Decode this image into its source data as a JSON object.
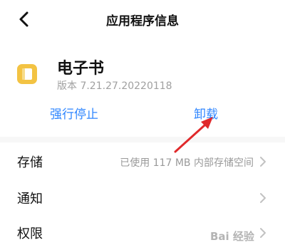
{
  "header": {
    "title": "应用程序信息",
    "back_icon": "chevron-left-icon"
  },
  "app": {
    "name": "电子书",
    "version": "版本 7.21.27.20220118",
    "icon": "ebook-app-icon",
    "icon_color": "#f3c343"
  },
  "actions": {
    "force_stop": "强行停止",
    "uninstall": "卸载",
    "accent_color": "#2f86ff"
  },
  "settings": {
    "rows": [
      {
        "label": "存储",
        "value": "已使用 117 MB 内部存储空间"
      },
      {
        "label": "通知",
        "value": ""
      },
      {
        "label": "权限",
        "value": ""
      }
    ]
  },
  "annotation": {
    "arrow_color": "#e0292b"
  },
  "watermark": {
    "text": "Bai 经验"
  }
}
